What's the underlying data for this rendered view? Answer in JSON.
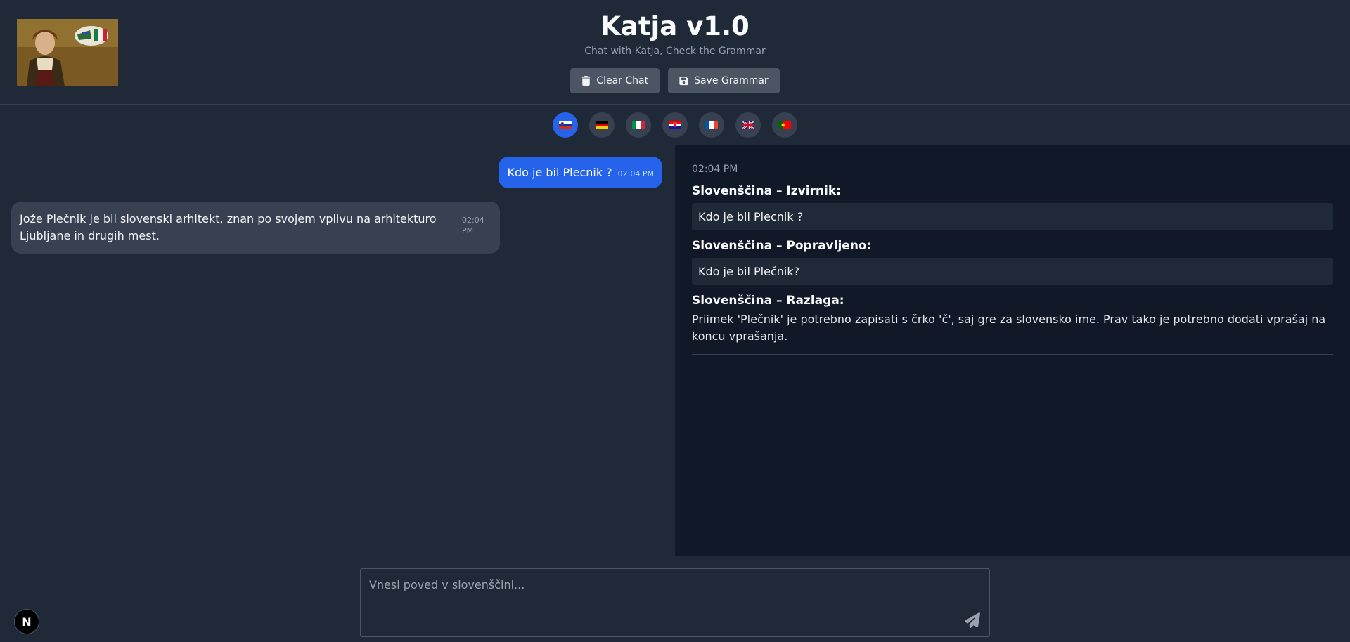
{
  "header": {
    "title": "Katja v1.0",
    "subtitle": "Chat with Katja, Check the Grammar",
    "clear_label": "Clear Chat",
    "save_label": "Save Grammar"
  },
  "languages": [
    {
      "code": "sl",
      "icon": "slovenia-flag-icon",
      "active": true
    },
    {
      "code": "de",
      "icon": "germany-flag-icon",
      "active": false
    },
    {
      "code": "it",
      "icon": "italy-flag-icon",
      "active": false
    },
    {
      "code": "hr",
      "icon": "croatia-flag-icon",
      "active": false
    },
    {
      "code": "fr",
      "icon": "france-flag-icon",
      "active": false
    },
    {
      "code": "en",
      "icon": "uk-flag-icon",
      "active": false
    },
    {
      "code": "pt",
      "icon": "portugal-flag-icon",
      "active": false
    }
  ],
  "chat": {
    "messages": [
      {
        "role": "user",
        "text": "Kdo je bil Plecnik ?",
        "time": "02:04 PM"
      },
      {
        "role": "assistant",
        "text": "Jože Plečnik je bil slovenski arhitekt, znan po svojem vplivu na arhitekturo Ljubljane in drugih mest.",
        "time": "02:04 PM"
      }
    ]
  },
  "grammar": {
    "time": "02:04 PM",
    "original_label": "Slovenščina – Izvirnik:",
    "original_text": "Kdo je bil Plecnik ?",
    "corrected_label": "Slovenščina – Popravljeno:",
    "corrected_text": "Kdo je bil Plečnik?",
    "explanation_label": "Slovenščina – Razlaga:",
    "explanation_text": "Priimek 'Plečnik' je potrebno zapisati s črko 'č', saj gre za slovensko ime. Prav tako je potrebno dodati vprašaj na koncu vprašanja."
  },
  "input": {
    "placeholder": "Vnesi poved v slovenščini...",
    "value": ""
  },
  "badge": {
    "label": "N"
  },
  "colors": {
    "accent": "#2563eb",
    "background": "#1f2937",
    "panel_dark": "#111827",
    "button": "#4b5563"
  }
}
